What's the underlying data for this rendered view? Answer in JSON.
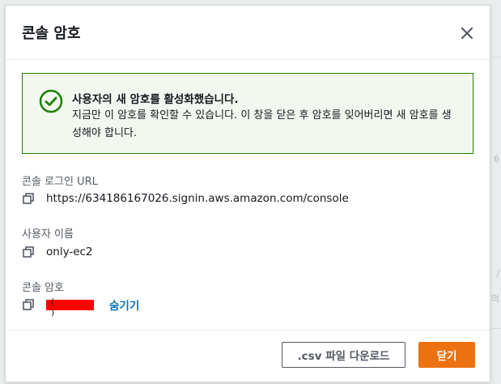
{
  "modal": {
    "title": "콘솔 암호",
    "close_label": "close"
  },
  "alert": {
    "title": "사용자의 새 암호를 활성화했습니다.",
    "message": "지금만 이 암호를 확인할 수 있습니다. 이 창을 닫은 후 암호를 잊어버리면 새 암호를 생성해야 합니다."
  },
  "fields": {
    "console_url": {
      "label": "콘솔 로그인 URL",
      "value": "https://634186167026.signin.aws.amazon.com/console"
    },
    "username": {
      "label": "사용자 이름",
      "value": "only-ec2"
    },
    "password": {
      "label": "콘솔 암호",
      "redacted_text": "(      )",
      "hide_label": "숨기기"
    }
  },
  "footer": {
    "download_csv_label": ".csv 파일 다운로드",
    "close_button_label": "닫기"
  },
  "colors": {
    "success": "#1d8102",
    "accent": "#ec7211",
    "link": "#0073bb",
    "redaction": "#ff0000"
  },
  "icons": [
    "close-icon",
    "check-circle-icon",
    "copy-icon"
  ]
}
